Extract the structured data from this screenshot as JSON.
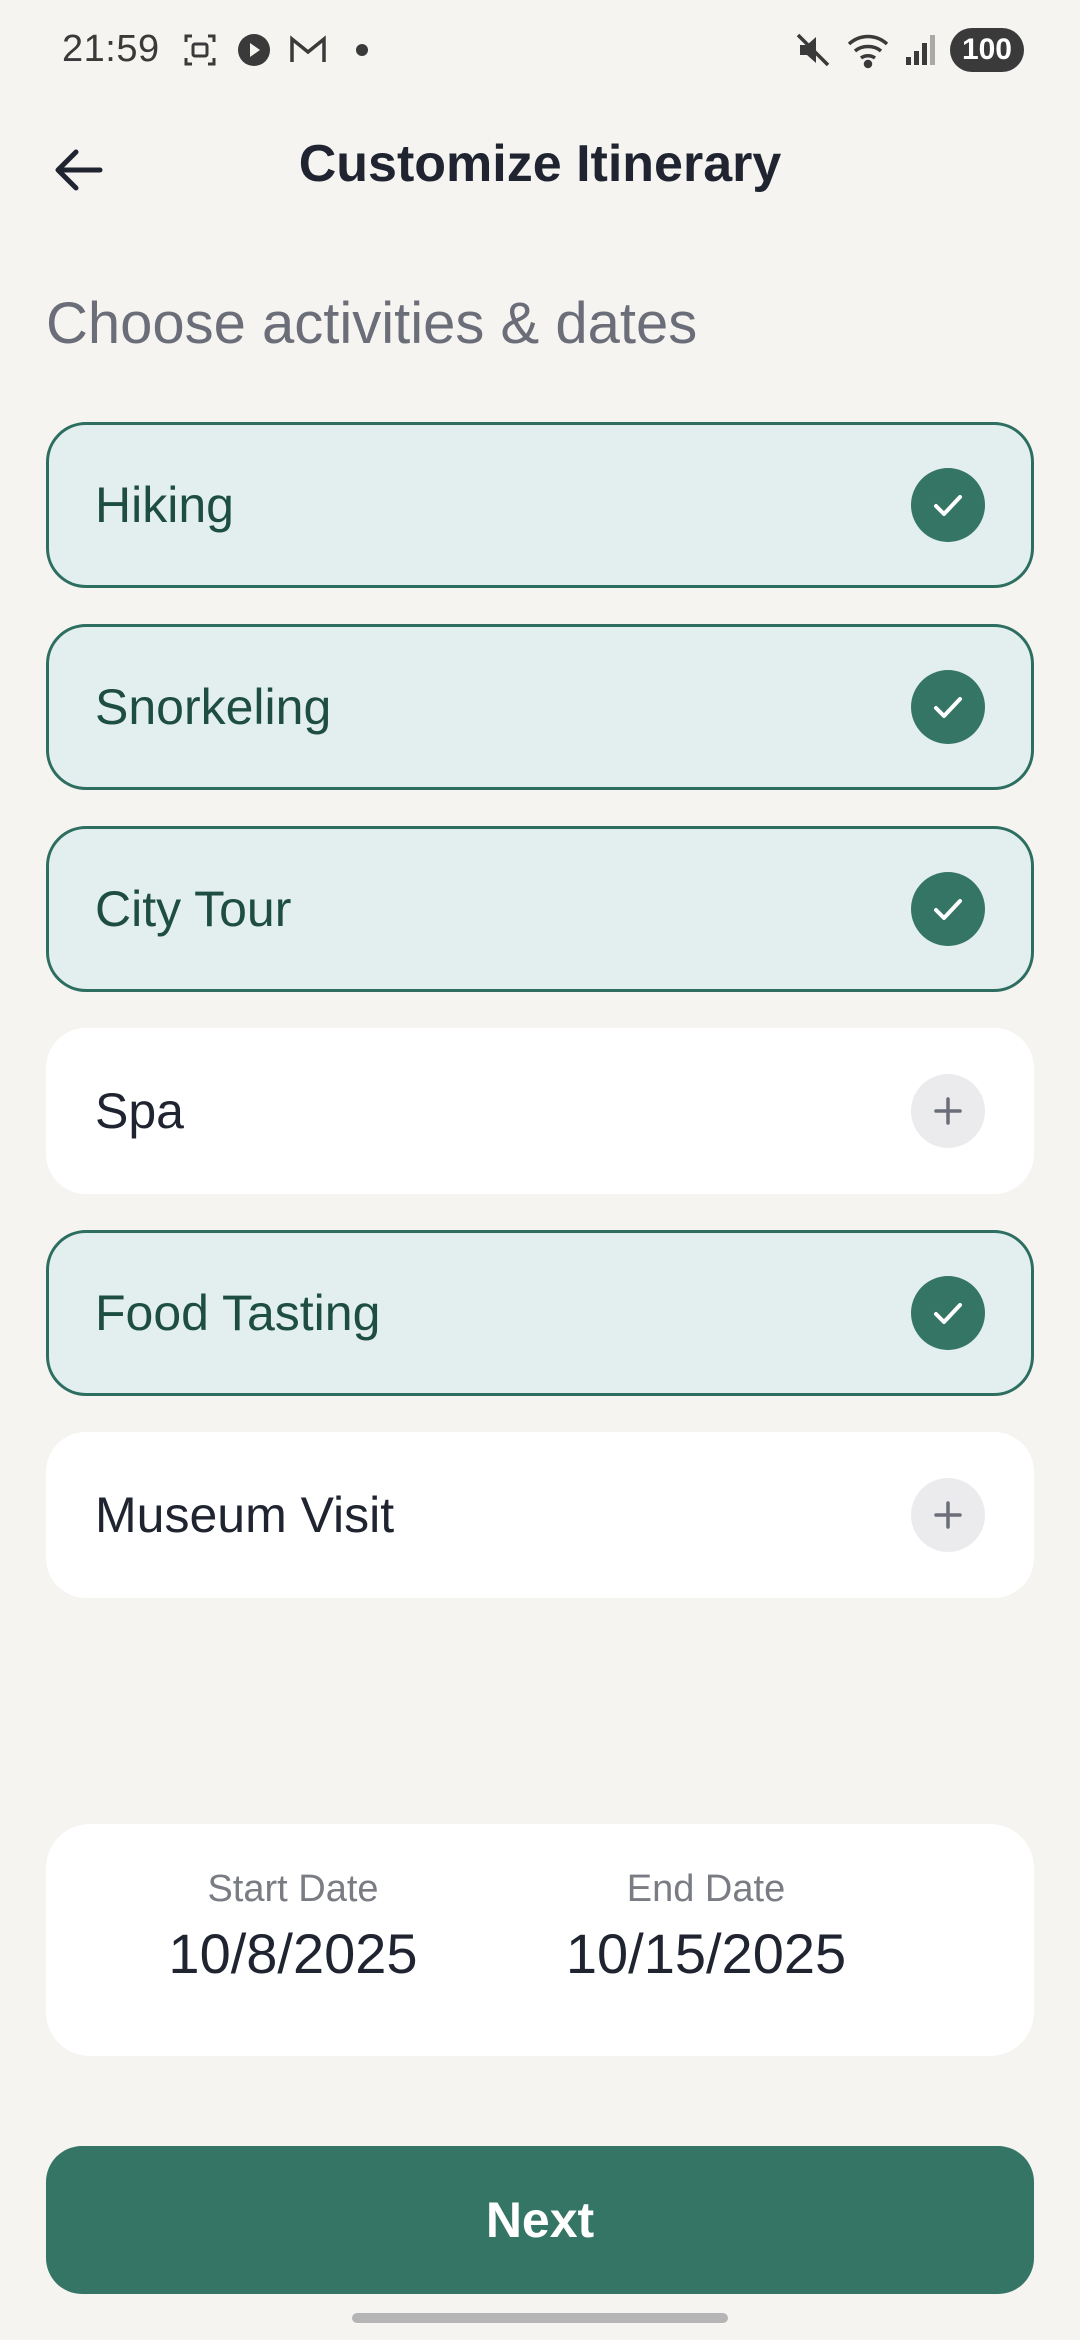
{
  "status_bar": {
    "time": "21:59",
    "battery": "100",
    "left_icons": [
      "screenshot-icon",
      "media-icon",
      "gmail-icon",
      "dot-icon"
    ],
    "right_icons": [
      "mute-icon",
      "wifi-icon",
      "signal-icon"
    ]
  },
  "header": {
    "title": "Customize Itinerary",
    "back_icon": "arrow-left-icon"
  },
  "section_heading": "Choose activities & dates",
  "activities": [
    {
      "label": "Hiking",
      "selected": true
    },
    {
      "label": "Snorkeling",
      "selected": true
    },
    {
      "label": "City Tour",
      "selected": true
    },
    {
      "label": "Spa",
      "selected": false
    },
    {
      "label": "Food Tasting",
      "selected": true
    },
    {
      "label": "Museum Visit",
      "selected": false
    }
  ],
  "dates": {
    "start_label": "Start Date",
    "start_value": "10/8/2025",
    "end_label": "End Date",
    "end_value": "10/15/2025"
  },
  "next_button": "Next",
  "colors": {
    "accent": "#357565",
    "selected_bg": "#e2efee",
    "background": "#f5f4f1"
  }
}
